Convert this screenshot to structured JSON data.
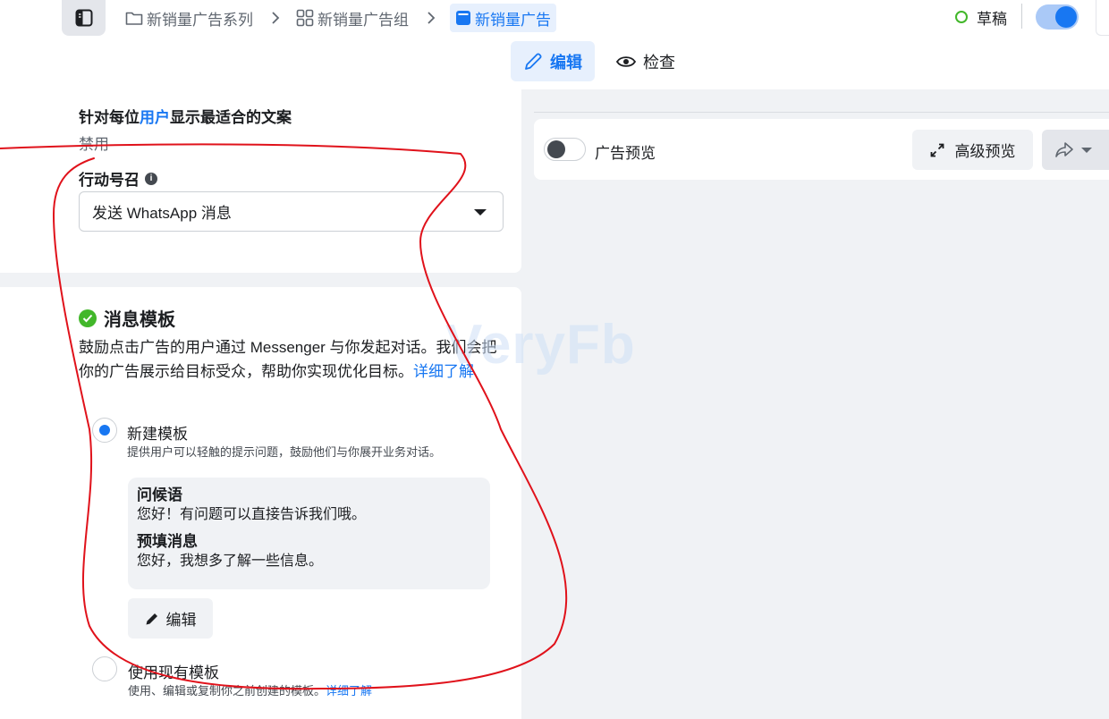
{
  "breadcrumb": {
    "campaign": "新销量广告系列",
    "adset": "新销量广告组",
    "ad": "新销量广告"
  },
  "status": {
    "label": "草稿"
  },
  "mode_tabs": {
    "edit": "编辑",
    "review": "检查"
  },
  "personalization": {
    "title_prefix": "针对每位",
    "title_link": "用户",
    "title_suffix": "显示最适合的文案",
    "value": "禁用"
  },
  "cta": {
    "label": "行动号召",
    "selected": "发送 WhatsApp 消息"
  },
  "message_template": {
    "title": "消息模板",
    "desc": "鼓励点击广告的用户通过 Messenger 与你发起对话。我们会把你的广告展示给目标受众，帮助你实现优化目标。",
    "learn_more": "详细了解",
    "option_new": {
      "title": "新建模板",
      "sub": "提供用户可以轻触的提示问题，鼓励他们与你展开业务对话。"
    },
    "greeting_label": "问候语",
    "greeting_value": "您好！有问题可以直接告诉我们哦。",
    "prefill_label": "预填消息",
    "prefill_value": "您好，我想多了解一些信息。",
    "edit_label": "编辑",
    "option_existing": {
      "title": "使用现有模板",
      "sub": "使用、编辑或复制你之前创建的模板。",
      "learn_more": "详细了解"
    }
  },
  "preview": {
    "toggle_label": "广告预览",
    "advanced_label": "高级预览"
  },
  "watermark": "VeryFb",
  "colors": {
    "accent": "#1877f2",
    "success": "#42b72a",
    "annotation": "#e0121b"
  }
}
